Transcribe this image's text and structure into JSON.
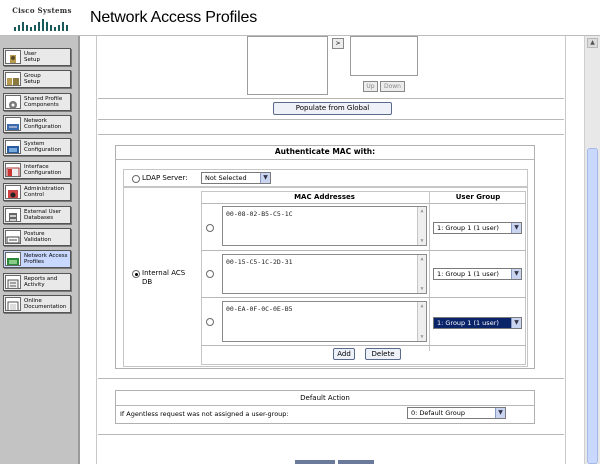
{
  "header": {
    "logo_text": "Cisco Systems",
    "title": "Network Access Profiles"
  },
  "sidebar": {
    "items": [
      {
        "label": "User\nSetup",
        "icon": "user-icon"
      },
      {
        "label": "Group\nSetup",
        "icon": "group-icon"
      },
      {
        "label": "Shared Profile\nComponents",
        "icon": "shared-profile-icon"
      },
      {
        "label": "Network\nConfiguration",
        "icon": "network-icon"
      },
      {
        "label": "System\nConfiguration",
        "icon": "system-icon"
      },
      {
        "label": "Interface\nConfiguration",
        "icon": "interface-icon"
      },
      {
        "label": "Administration\nControl",
        "icon": "administration-icon"
      },
      {
        "label": "External User\nDatabases",
        "icon": "database-icon"
      },
      {
        "label": "Posture\nValidation",
        "icon": "posture-icon"
      },
      {
        "label": "Network Access\nProfiles",
        "icon": "network-access-icon"
      },
      {
        "label": "Reports and\nActivity",
        "icon": "reports-icon"
      },
      {
        "label": "Online\nDocumentation",
        "icon": "documentation-icon"
      }
    ]
  },
  "top_section": {
    "arrow_label": ">",
    "up_label": "Up",
    "down_label": "Down",
    "populate_label": "Populate from Global"
  },
  "auth_mac": {
    "title": "Authenticate MAC with:",
    "ldap_label": "LDAP Server:",
    "ldap_selected": "Not Selected",
    "internal_label": "Internal ACS\nDB",
    "col_mac": "MAC Addresses",
    "col_group": "User Group",
    "rows": [
      {
        "mac": "00-08-02-B5-C5-1C",
        "group": "1: Group 1 (1 user)"
      },
      {
        "mac": "00-15-C5-1C-2D-31",
        "group": "1: Group 1 (1 user)"
      },
      {
        "mac": "00-EA-0F-0C-0E-B5",
        "group": "1: Group 1 (1 user)"
      }
    ],
    "add_label": "Add",
    "delete_label": "Delete"
  },
  "default_action": {
    "title": "Default Action",
    "prompt": "If Agentless request was not assigned a user-group:",
    "selected": "0: Default Group"
  },
  "colors": {
    "sidebar_bg": "#c3c3c3",
    "highlight": "#0a246a",
    "active_nav": "#c8d8ff"
  }
}
